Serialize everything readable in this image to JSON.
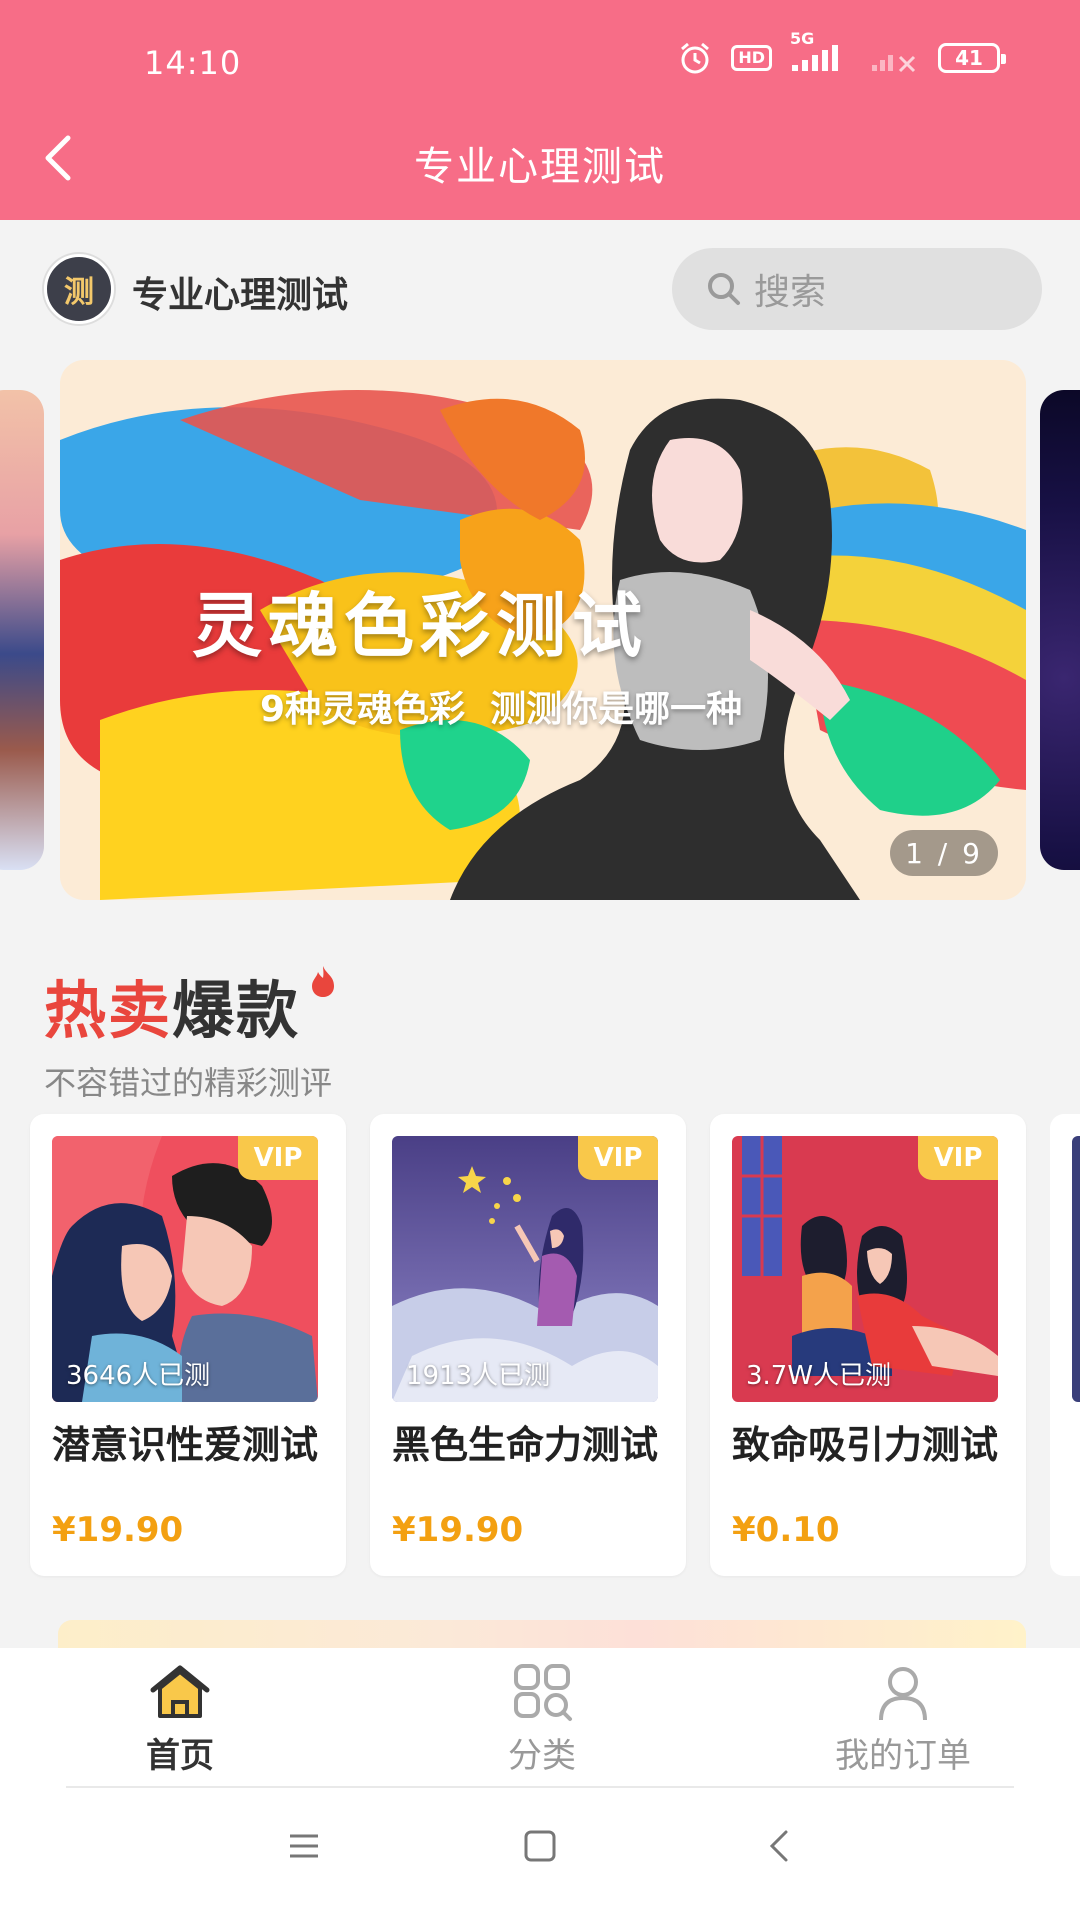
{
  "status_bar": {
    "time": "14:10",
    "hd_label": "HD",
    "network_label": "5G",
    "battery": "41"
  },
  "header": {
    "title": "专业心理测试",
    "back_icon": "chevron-left-icon"
  },
  "brand": {
    "logo_text": "测",
    "name": "专业心理测试"
  },
  "search": {
    "placeholder": "搜索"
  },
  "banner": {
    "title": "灵魂色彩测试",
    "subtitle": "9种灵魂色彩  测测你是哪一种",
    "indicator": "1 / 9"
  },
  "hot_section": {
    "title_highlight": "热卖",
    "title_rest": "爆款",
    "subtitle": "不容错过的精彩测评"
  },
  "products": [
    {
      "name": "潜意识性爱测试",
      "price": "¥19.90",
      "tested": "3646人已测",
      "badge": "VIP"
    },
    {
      "name": "黑色生命力测试",
      "price": "¥19.90",
      "tested": "1913人已测",
      "badge": "VIP"
    },
    {
      "name": "致命吸引力测试",
      "price": "¥0.10",
      "tested": "3.7W人已测",
      "badge": "VIP"
    }
  ],
  "bottom_nav": {
    "items": [
      {
        "label": "首页",
        "icon": "home-icon",
        "active": true
      },
      {
        "label": "分类",
        "icon": "category-icon",
        "active": false
      },
      {
        "label": "我的订单",
        "icon": "user-icon",
        "active": false
      }
    ]
  },
  "colors": {
    "brand": "#f76d87",
    "price": "#f3a011",
    "hot": "#e9463d",
    "vip": "#f9c84a"
  }
}
